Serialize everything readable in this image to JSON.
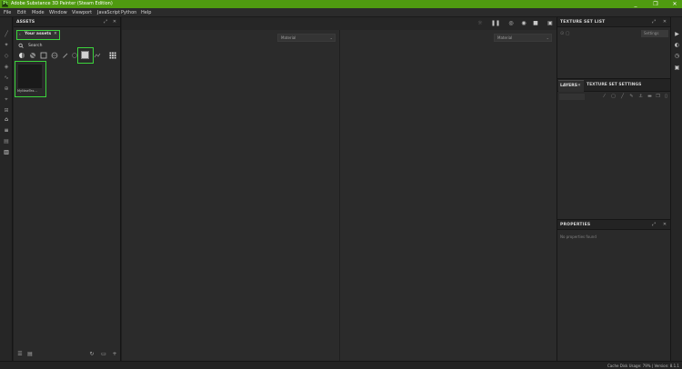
{
  "app": {
    "logo": "Pt",
    "title": "Adobe Substance 3D Painter (Steam Edition)",
    "window_buttons": [
      "_",
      "❐",
      "✕"
    ]
  },
  "menu": [
    "File",
    "Edit",
    "Mode",
    "Window",
    "Viewport",
    "JavaScript",
    "Python",
    "Help"
  ],
  "assets": {
    "title": "ASSETS",
    "tab_label": "Your assets",
    "search_label": "Search",
    "items": [
      {
        "name": "MyNewTex..."
      }
    ]
  },
  "viewport": {
    "left_dropdown": "Material",
    "right_dropdown": "Material"
  },
  "texture_set_list": {
    "title": "TEXTURE SET LIST",
    "settings_label": "Settings"
  },
  "layers": {
    "tab_label": "LAYERS",
    "tab2_label": "TEXTURE SET SETTINGS"
  },
  "properties": {
    "title": "PROPERTIES",
    "empty_text": "No properties found"
  },
  "status": {
    "text": "Cache Disk Usage:   79% | Version: 8.1.1"
  }
}
